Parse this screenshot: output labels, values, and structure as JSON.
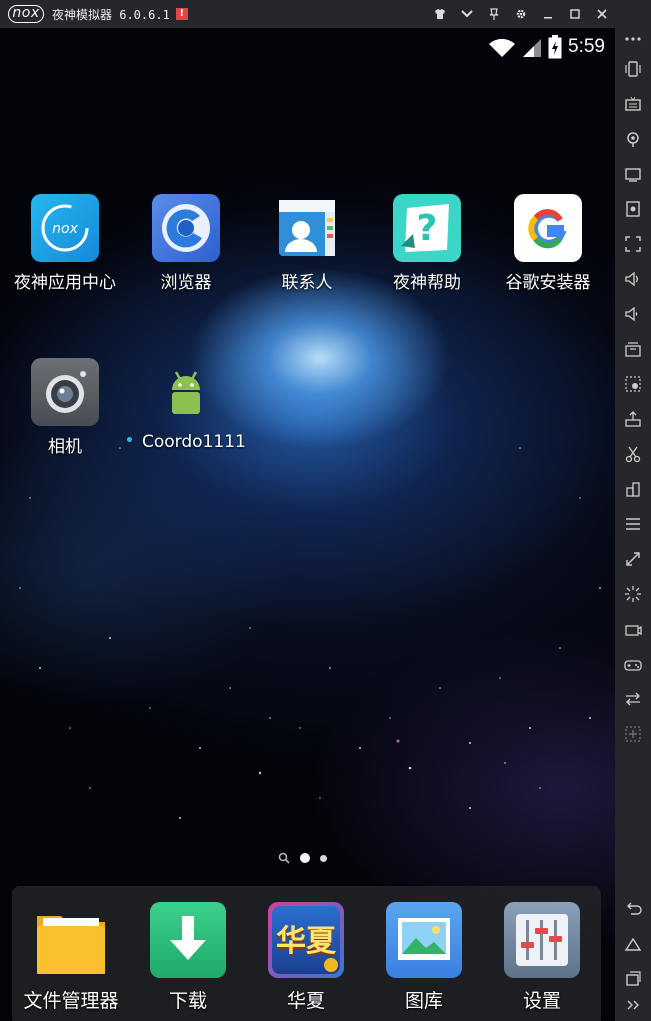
{
  "window": {
    "title": "夜神模拟器 6.0.6.1",
    "logo_text": "nox",
    "alert_badge": "!"
  },
  "status_bar": {
    "time": "5:59"
  },
  "home_apps": [
    {
      "label": "夜神应用中心",
      "icon": "nox-app-center-icon"
    },
    {
      "label": "浏览器",
      "icon": "browser-icon"
    },
    {
      "label": "联系人",
      "icon": "contacts-icon"
    },
    {
      "label": "夜神帮助",
      "icon": "help-icon"
    },
    {
      "label": "谷歌安装器",
      "icon": "google-installer-icon"
    },
    {
      "label": "相机",
      "icon": "camera-icon"
    },
    {
      "label": "Coordo1111",
      "icon": "android-icon"
    }
  ],
  "dock_apps": [
    {
      "label": "文件管理器",
      "icon": "folder-icon"
    },
    {
      "label": "下载",
      "icon": "download-icon"
    },
    {
      "label": "华夏",
      "icon": "huaxia-game-icon",
      "badge_text": "华夏"
    },
    {
      "label": "图库",
      "icon": "gallery-icon"
    },
    {
      "label": "设置",
      "icon": "settings-icon"
    }
  ],
  "page_indicator": {
    "current_page": 1,
    "total_pages": 2
  },
  "colors": {
    "titlebar": "#26272b",
    "alert": "#e24545",
    "accent": "#39b6e8"
  }
}
